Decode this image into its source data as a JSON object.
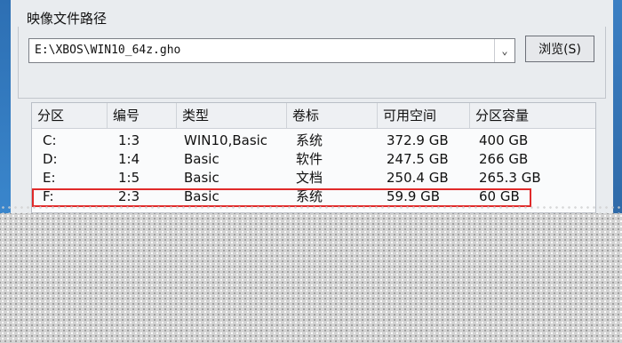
{
  "section": {
    "title": "映像文件路径"
  },
  "path_field": {
    "value": "E:\\XBOS\\WIN10_64z.gho"
  },
  "browse_button": {
    "label": "浏览(S)"
  },
  "dropdown_icon": "chevron-down-icon",
  "table": {
    "headers": [
      "分区",
      "编号",
      "类型",
      "卷标",
      "可用空间",
      "分区容量"
    ],
    "rows": [
      [
        "C:",
        "1:3",
        "WIN10,Basic",
        "系统",
        "372.9 GB",
        "400 GB"
      ],
      [
        "D:",
        "1:4",
        "Basic",
        "软件",
        "247.5 GB",
        "266 GB"
      ],
      [
        "E:",
        "1:5",
        "Basic",
        "文档",
        "250.4 GB",
        "265.3 GB"
      ],
      [
        "F:",
        "2:3",
        "Basic",
        "系统",
        "59.9 GB",
        "60 GB"
      ]
    ],
    "highlighted_row": 3,
    "highlight_color": "#e02a2a"
  }
}
